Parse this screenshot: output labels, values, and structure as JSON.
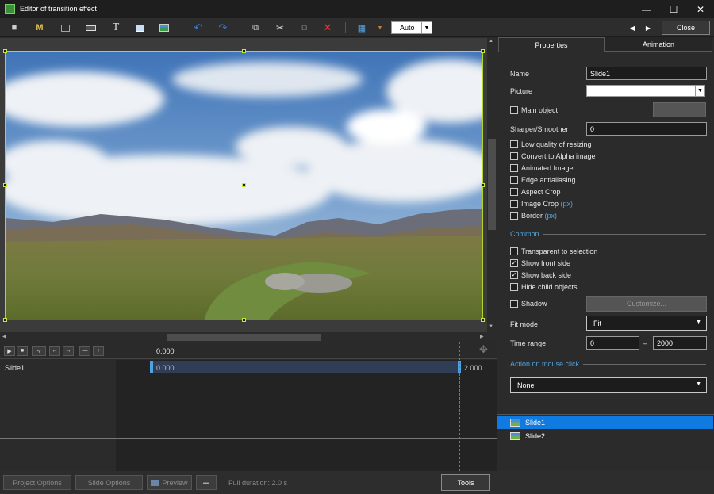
{
  "window": {
    "title": "Editor of transition effect"
  },
  "toolbar": {
    "zoom_value": "Auto",
    "close_label": "Close"
  },
  "tabs": {
    "properties": "Properties",
    "animation": "Animation"
  },
  "props": {
    "name_label": "Name",
    "name_value": "Slide1",
    "picture_label": "Picture",
    "picture_value": "",
    "main_object_label": "Main object",
    "sharper_label": "Sharper/Smoother",
    "sharper_value": "0",
    "low_quality_label": "Low quality of resizing",
    "alpha_label": "Convert to Alpha image",
    "animated_label": "Animated Image",
    "edge_label": "Edge antialiasing",
    "aspect_label": "Aspect Crop",
    "imgcrop_label": "Image Crop",
    "imgcrop_unit": "(px)",
    "border_label": "Border",
    "border_unit": "(px)",
    "common_label": "Common",
    "transparent_label": "Transparent to selection",
    "front_label": "Show front side",
    "back_label": "Show back side",
    "hide_child_label": "Hide child objects",
    "shadow_label": "Shadow",
    "customize_label": "Customize...",
    "fitmode_label": "Fit mode",
    "fitmode_value": "Fit",
    "timerange_label": "Time range",
    "timerange_from": "0",
    "timerange_dash": "–",
    "timerange_to": "2000",
    "action_label": "Action on mouse click",
    "action_value": "None"
  },
  "checks": {
    "front": true,
    "back": true
  },
  "slides": [
    "Slide1",
    "Slide2"
  ],
  "timeline": {
    "time_cursor": "0.000",
    "start_label": "0.000",
    "end_label": "2.000",
    "track_name": "Slide1"
  },
  "bottom": {
    "project_options": "Project Options",
    "slide_options": "Slide Options",
    "preview": "Preview",
    "duration": "Full duration: 2.0 s",
    "tools": "Tools"
  }
}
